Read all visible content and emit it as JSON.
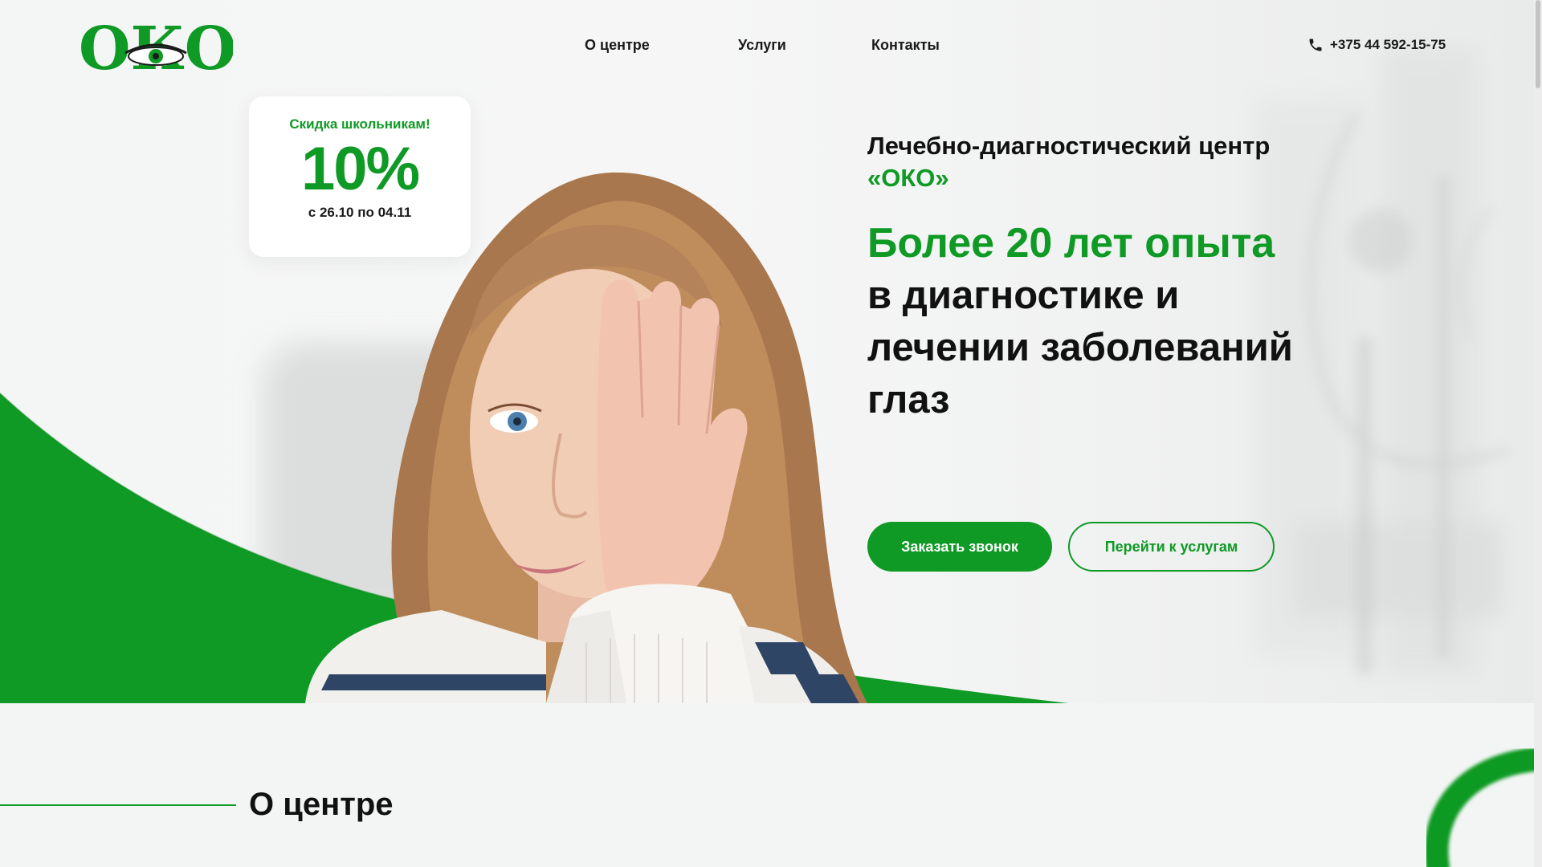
{
  "header": {
    "logo_text": "ОКО",
    "nav": [
      {
        "label": "О центре"
      },
      {
        "label": "Услуги"
      },
      {
        "label": "Контакты"
      }
    ],
    "phone": "+375 44 592-15-75",
    "phone_icon": "phone-icon"
  },
  "promo": {
    "title": "Скидка школьникам!",
    "percent": "10%",
    "dates": "с 26.10 по 04.11"
  },
  "hero": {
    "subtitle_prefix": "Лечебно-диагностический центр ",
    "subtitle_brand": "«ОКО»",
    "headline_green": "Более 20 лет опыта",
    "headline_dark": "в диагностике и лечении заболеваний глаз",
    "primary_button": "Заказать звонок",
    "secondary_button": "Перейти к услугам"
  },
  "about": {
    "title": "О центре"
  },
  "colors": {
    "brand_green": "#0e9a24",
    "text_dark": "#111111",
    "background": "#f3f5f4"
  }
}
